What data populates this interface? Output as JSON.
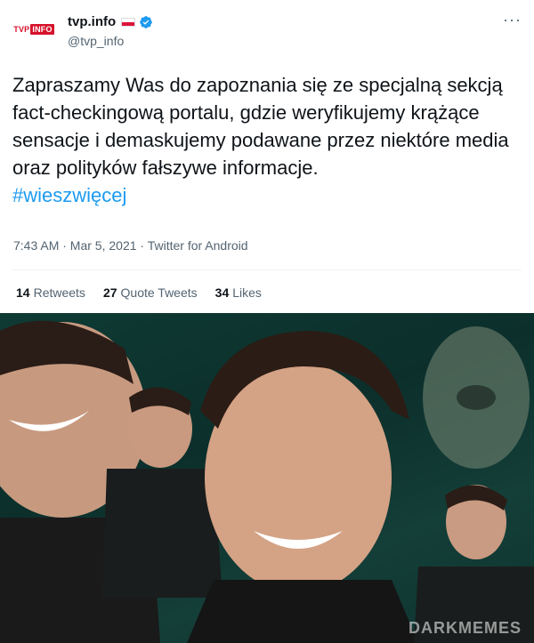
{
  "account": {
    "display_name": "tvp.info",
    "handle": "@tvp_info",
    "logo_text_tvp": "TVP",
    "logo_text_info": "INFO",
    "verified": true,
    "flag": "poland-flag-icon"
  },
  "tweet": {
    "body": "Zapraszamy Was do zapoznania się ze specjalną sekcją fact-checkingową portalu, gdzie weryfikujemy krążące sensacje i demaskujemy podawane przez niektóre media oraz polityków fałszywe informacje.",
    "hashtag": "#wieszwięcej",
    "meta": "7:43 AM · Mar 5, 2021 · Twitter for Android"
  },
  "stats": {
    "retweets_count": "14",
    "retweets_label": "Retweets",
    "quotes_count": "27",
    "quotes_label": "Quote Tweets",
    "likes_count": "34",
    "likes_label": "Likes"
  },
  "photo": {
    "watermark": "DARKMEMES"
  },
  "colors": {
    "link": "#1d9bf0",
    "verified": "#1d9bf0",
    "brand_red": "#d6122b"
  }
}
